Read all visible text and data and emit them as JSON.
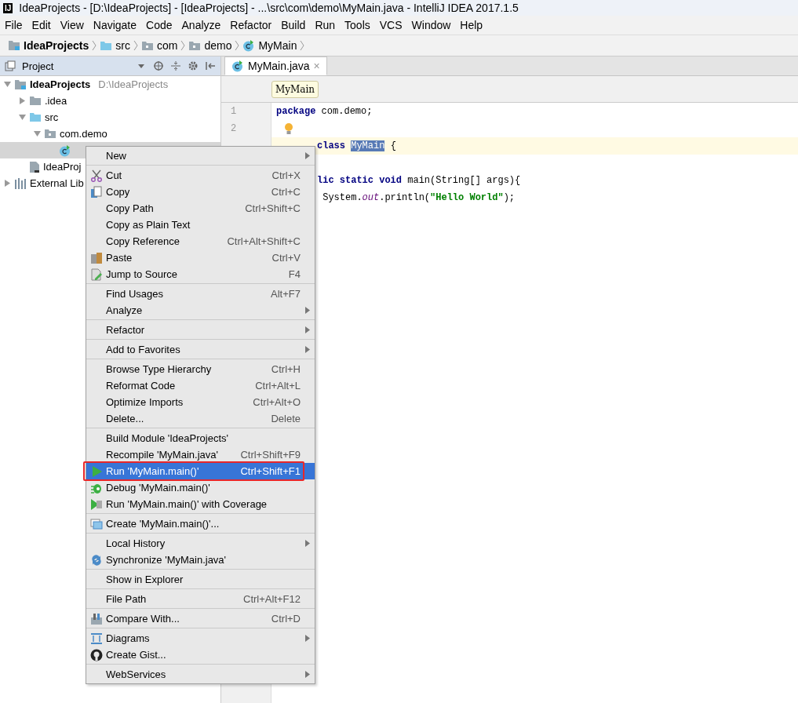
{
  "window": {
    "logo": "IJ",
    "title": "IdeaProjects - [D:\\IdeaProjects] - [IdeaProjects] - ...\\src\\com\\demo\\MyMain.java - IntelliJ IDEA 2017.1.5"
  },
  "menu_bar": [
    "File",
    "Edit",
    "View",
    "Navigate",
    "Code",
    "Analyze",
    "Refactor",
    "Build",
    "Run",
    "Tools",
    "VCS",
    "Window",
    "Help"
  ],
  "breadcrumbs": [
    {
      "label": "IdeaProjects",
      "kind": "module"
    },
    {
      "label": "src",
      "kind": "source-folder"
    },
    {
      "label": "com",
      "kind": "package"
    },
    {
      "label": "demo",
      "kind": "package"
    },
    {
      "label": "MyMain",
      "kind": "class"
    }
  ],
  "project_panel": {
    "title": "Project",
    "tree": [
      {
        "label": "IdeaProjects",
        "hint": "D:\\IdeaProjects",
        "kind": "module",
        "expanded": true,
        "selected": false,
        "children": [
          {
            "label": ".idea",
            "kind": "folder",
            "expanded": false,
            "selected": false
          },
          {
            "label": "src",
            "kind": "source-folder",
            "expanded": true,
            "selected": false,
            "children": [
              {
                "label": "com.demo",
                "kind": "package",
                "expanded": true,
                "selected": false,
                "children": [
                  {
                    "kind": "class",
                    "selected": true
                  }
                ]
              }
            ]
          },
          {
            "label": "IdeaProj",
            "kind": "file",
            "selected": false
          }
        ]
      },
      {
        "label": "External Lib",
        "kind": "library",
        "expanded": false,
        "selected": false
      }
    ]
  },
  "editor": {
    "tabs": [
      {
        "label": "MyMain.java",
        "close": "×",
        "selected": true
      }
    ],
    "structure_crumb": "MyMain",
    "lines": [
      {
        "kind": "full",
        "number": "1",
        "current": false,
        "tokens": [
          {
            "t": "package",
            "kind": "keyword"
          },
          {
            "t": " com.demo;",
            "kind": "plain"
          }
        ]
      },
      {
        "kind": "full",
        "number": "2",
        "current": false,
        "bulb": true
      },
      {
        "kind": "clipped",
        "current": true,
        "tokens": [
          {
            "t": "class ",
            "kind": "keyword"
          },
          {
            "t": "MyMain",
            "kind": "selection"
          },
          {
            "t": " {",
            "kind": "plain"
          }
        ]
      },
      {
        "kind": "clipped",
        "current": false
      },
      {
        "kind": "clipped",
        "current": false,
        "tokens": [
          {
            "t": "lic static void",
            "kind": "keyword"
          },
          {
            "t": " main(String[] args){",
            "kind": "plain"
          }
        ]
      },
      {
        "kind": "clipped",
        "current": false,
        "tokens": [
          {
            "t": " System.",
            "kind": "plain"
          },
          {
            "t": "out",
            "kind": "field"
          },
          {
            "t": ".println(",
            "kind": "plain"
          },
          {
            "t": "\"Hello World\"",
            "kind": "string"
          },
          {
            "t": ");",
            "kind": "plain"
          }
        ]
      }
    ]
  },
  "context_menu": {
    "groups": [
      [
        {
          "label": "New",
          "submenu": true,
          "selected": false,
          "outlined": false
        }
      ],
      [
        {
          "label": "Cut",
          "shortcut": "Ctrl+X",
          "kind": "cut",
          "submenu": false,
          "selected": false,
          "outlined": false
        },
        {
          "label": "Copy",
          "shortcut": "Ctrl+C",
          "kind": "copy",
          "submenu": false,
          "selected": false,
          "outlined": false
        },
        {
          "label": "Copy Path",
          "shortcut": "Ctrl+Shift+C",
          "submenu": false,
          "selected": false,
          "outlined": false
        },
        {
          "label": "Copy as Plain Text",
          "submenu": false,
          "selected": false,
          "outlined": false
        },
        {
          "label": "Copy Reference",
          "shortcut": "Ctrl+Alt+Shift+C",
          "submenu": false,
          "selected": false,
          "outlined": false
        },
        {
          "label": "Paste",
          "shortcut": "Ctrl+V",
          "kind": "paste",
          "submenu": false,
          "selected": false,
          "outlined": false
        },
        {
          "label": "Jump to Source",
          "shortcut": "F4",
          "kind": "jump",
          "submenu": false,
          "selected": false,
          "outlined": false
        }
      ],
      [
        {
          "label": "Find Usages",
          "shortcut": "Alt+F7",
          "submenu": false,
          "selected": false,
          "outlined": false
        },
        {
          "label": "Analyze",
          "submenu": true,
          "selected": false,
          "outlined": false
        }
      ],
      [
        {
          "label": "Refactor",
          "submenu": true,
          "selected": false,
          "outlined": false
        }
      ],
      [
        {
          "label": "Add to Favorites",
          "submenu": true,
          "selected": false,
          "outlined": false
        }
      ],
      [
        {
          "label": "Browse Type Hierarchy",
          "shortcut": "Ctrl+H",
          "submenu": false,
          "selected": false,
          "outlined": false
        },
        {
          "label": "Reformat Code",
          "shortcut": "Ctrl+Alt+L",
          "submenu": false,
          "selected": false,
          "outlined": false
        },
        {
          "label": "Optimize Imports",
          "shortcut": "Ctrl+Alt+O",
          "submenu": false,
          "selected": false,
          "outlined": false
        },
        {
          "label": "Delete...",
          "shortcut": "Delete",
          "submenu": false,
          "selected": false,
          "outlined": false
        }
      ],
      [
        {
          "label": "Build Module 'IdeaProjects'",
          "submenu": false,
          "selected": false,
          "outlined": false
        },
        {
          "label": "Recompile 'MyMain.java'",
          "shortcut": "Ctrl+Shift+F9",
          "submenu": false,
          "selected": false,
          "outlined": false
        },
        {
          "label": "Run 'MyMain.main()'",
          "shortcut": "Ctrl+Shift+F1",
          "kind": "run",
          "submenu": false,
          "selected": true,
          "outlined": true
        },
        {
          "label": "Debug 'MyMain.main()'",
          "kind": "debug",
          "submenu": false,
          "selected": false,
          "outlined": false
        },
        {
          "label": "Run 'MyMain.main()' with Coverage",
          "kind": "coverage",
          "submenu": false,
          "selected": false,
          "outlined": false
        }
      ],
      [
        {
          "label": "Create 'MyMain.main()'...",
          "kind": "create",
          "submenu": false,
          "selected": false,
          "outlined": false
        }
      ],
      [
        {
          "label": "Local History",
          "submenu": true,
          "selected": false,
          "outlined": false
        },
        {
          "label": "Synchronize 'MyMain.java'",
          "kind": "sync",
          "submenu": false,
          "selected": false,
          "outlined": false
        }
      ],
      [
        {
          "label": "Show in Explorer",
          "submenu": false,
          "selected": false,
          "outlined": false
        }
      ],
      [
        {
          "label": "File Path",
          "shortcut": "Ctrl+Alt+F12",
          "submenu": false,
          "selected": false,
          "outlined": false
        }
      ],
      [
        {
          "label": "Compare With...",
          "shortcut": "Ctrl+D",
          "kind": "compare",
          "submenu": false,
          "selected": false,
          "outlined": false
        }
      ],
      [
        {
          "label": "Diagrams",
          "kind": "diagrams",
          "submenu": true,
          "selected": false,
          "outlined": false
        },
        {
          "label": "Create Gist...",
          "kind": "gist",
          "submenu": false,
          "selected": false,
          "outlined": false
        }
      ],
      [
        {
          "label": "WebServices",
          "submenu": true,
          "selected": false,
          "outlined": false
        }
      ]
    ]
  }
}
